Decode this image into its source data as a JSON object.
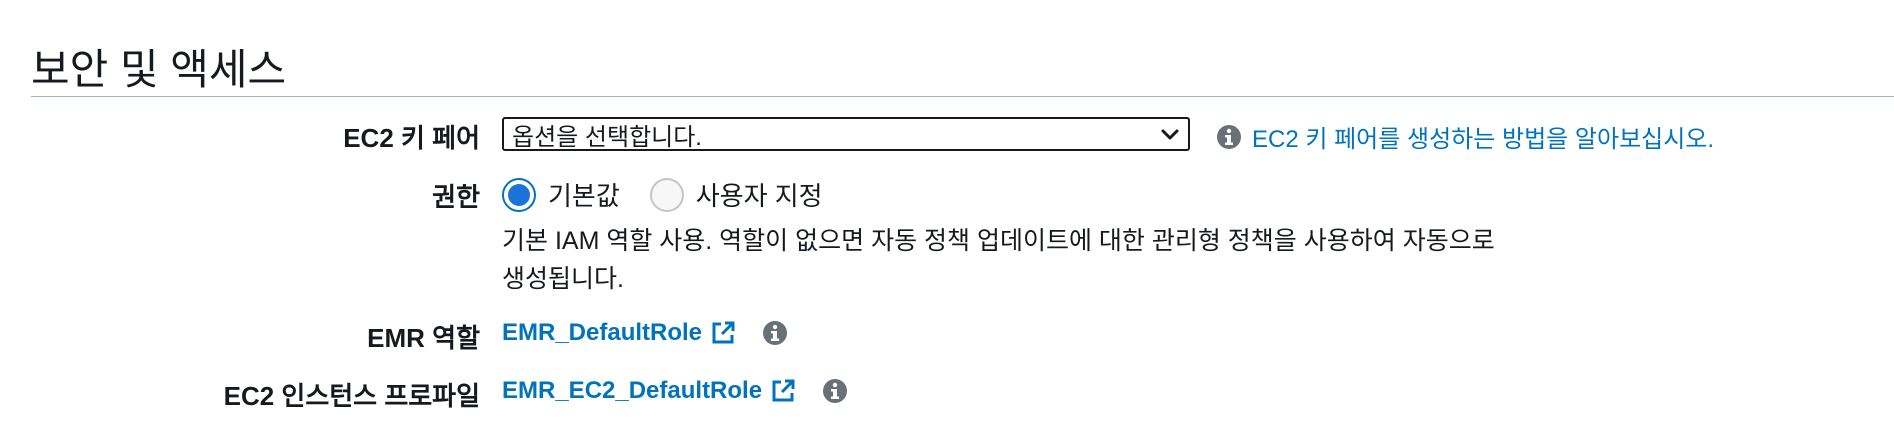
{
  "section": {
    "title": "보안 및 액세스"
  },
  "ec2_key_pair": {
    "label": "EC2 키 페어",
    "select_value": "옵션을 선택합니다.",
    "help_link": "EC2 키 페어를 생성하는 방법을 알아보십시오."
  },
  "permissions": {
    "label": "권한",
    "options": [
      {
        "label": "기본값",
        "selected": true
      },
      {
        "label": "사용자 지정",
        "selected": false
      }
    ],
    "description": "기본 IAM 역할 사용. 역할이 없으면 자동 정책 업데이트에 대한 관리형 정책을 사용하여 자동으로 생성됩니다."
  },
  "emr_role": {
    "label": "EMR 역할",
    "value": "EMR_DefaultRole"
  },
  "ec2_instance_profile": {
    "label": "EC2 인스턴스 프로파일",
    "value": "EMR_EC2_DefaultRole"
  },
  "colors": {
    "link": "#0073bb",
    "radio_selected": "#1a73d6",
    "text": "#16191f",
    "icon_gray": "#687078"
  }
}
